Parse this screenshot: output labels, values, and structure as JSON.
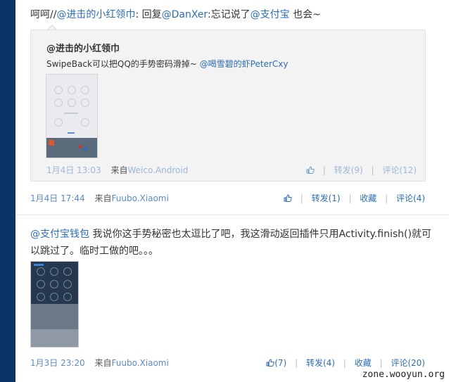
{
  "post1": {
    "text_prefix": "呵呵//",
    "mention1": "@进击的小红领巾",
    "text_mid1": ": 回复",
    "mention2": "@DanXer",
    "text_mid2": ":忘记说了",
    "mention3": "@支付宝",
    "text_suffix": " 也会~",
    "time": "1月4日 17:44",
    "source_label": "来自",
    "source": "Fuubo.Xiaomi",
    "repost": "转发(1)",
    "favorite": "收藏",
    "comment": "评论(4)"
  },
  "quote": {
    "author": "@进击的小红领巾",
    "text": "SwipeBack可以把QQ的手势密码滑掉~ ",
    "mention": "@喝雪碧的虾PeterCxy",
    "time": "1月4日 13:03",
    "source_label": "来自",
    "source": "Weico.Android",
    "repost": "转发(9)",
    "comment": "评论(12)"
  },
  "post2": {
    "mention": "@支付宝钱包",
    "text": " 我说你这手势秘密也太逗比了吧，我这滑动返回插件只用Activity.finish()就可以跳过了。临时工做的吧。。。",
    "time": "1月3日 23:20",
    "source_label": "来自",
    "source": "Fuubo.Xiaomi",
    "like": "(7)",
    "repost": "转发(4)",
    "favorite": "收藏",
    "comment": "评论(20)"
  },
  "watermark": "zone.wooyun.org",
  "colors": {
    "sidebar": "#0b3567",
    "link": "#2b6eb5",
    "quote_bg": "#f3f3f3"
  },
  "icons": [
    "thumbs-up-icon"
  ]
}
